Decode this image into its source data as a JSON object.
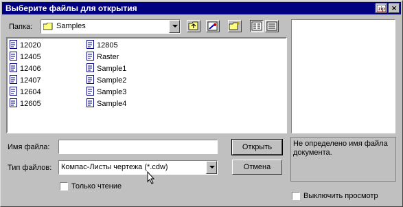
{
  "window": {
    "title": "Выберите файлы для открытия"
  },
  "folder": {
    "label": "Папка:",
    "value": "Samples"
  },
  "files": {
    "col1": [
      "12020",
      "12405",
      "12406",
      "12407",
      "12604",
      "12605"
    ],
    "col2": [
      "12805",
      "Raster",
      "Sample1",
      "Sample2",
      "Sample3",
      "Sample4"
    ]
  },
  "filename": {
    "label": "Имя файла:",
    "value": ""
  },
  "filetype": {
    "label": "Тип файлов:",
    "value": "Компас-Листы чертежа (*.cdw)"
  },
  "readonly": {
    "label": "Только чтение"
  },
  "buttons": {
    "open": "Открыть",
    "cancel": "Отмена"
  },
  "preview": {
    "message": "Не определено имя файла документа.",
    "disable_label": "Выключить просмотр"
  },
  "colors": {
    "titlebar": "#000080",
    "face": "#c0c0c0"
  }
}
